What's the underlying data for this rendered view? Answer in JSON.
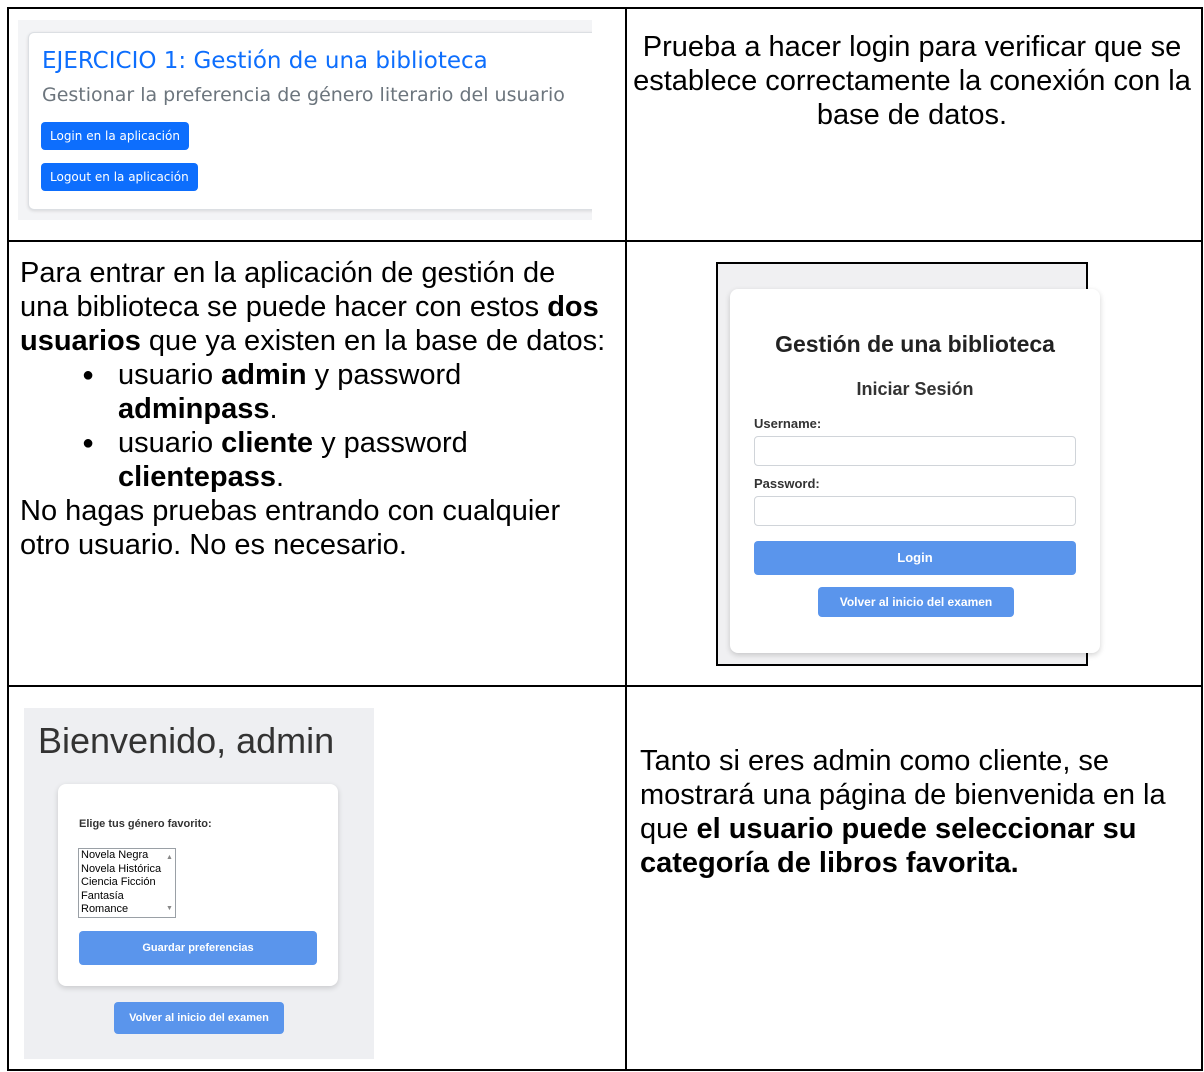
{
  "row1": {
    "screenshot": {
      "title": "EJERCICIO 1: Gestión de una biblioteca",
      "subtitle": "Gestionar la preferencia de género literario del usuario",
      "login_button": "Login en la aplicación",
      "logout_button": "Logout en la aplicación"
    },
    "text": "Prueba a hacer login para verificar que se establece correctamente la conexión con la base de datos."
  },
  "row2": {
    "intro_part1": "Para entrar en la aplicación de gestión de una biblioteca se puede hacer con estos ",
    "intro_bold": "dos usuarios",
    "intro_part2": " que ya existen en la base de datos:",
    "users": [
      {
        "prefix": "usuario ",
        "user": "admin",
        "mid": " y password ",
        "pass": "adminpass",
        "suffix": "."
      },
      {
        "prefix": "usuario ",
        "user": "cliente",
        "mid": " y password ",
        "pass": "clientepass",
        "suffix": "."
      }
    ],
    "outro": "No hagas pruebas entrando con cualquier otro usuario. No es necesario.",
    "login_form": {
      "title": "Gestión de una biblioteca",
      "subtitle": "Iniciar Sesión",
      "username_label": "Username:",
      "password_label": "Password:",
      "login_button": "Login",
      "back_button": "Volver al inicio del examen"
    }
  },
  "row3": {
    "welcome": {
      "heading": "Bienvenido, admin",
      "select_label": "Elige tus género favorito:",
      "options": [
        "Novela Negra",
        "Novela Histórica",
        "Ciencia Ficción",
        "Fantasía",
        "Romance"
      ],
      "save_button": "Guardar preferencias",
      "back_button": "Volver al inicio del examen"
    },
    "text_part1": "Tanto si eres admin como cliente, se mostrará una página de bienvenida en la que ",
    "text_bold": "el usuario puede seleccionar su categoría de libros favorita."
  }
}
